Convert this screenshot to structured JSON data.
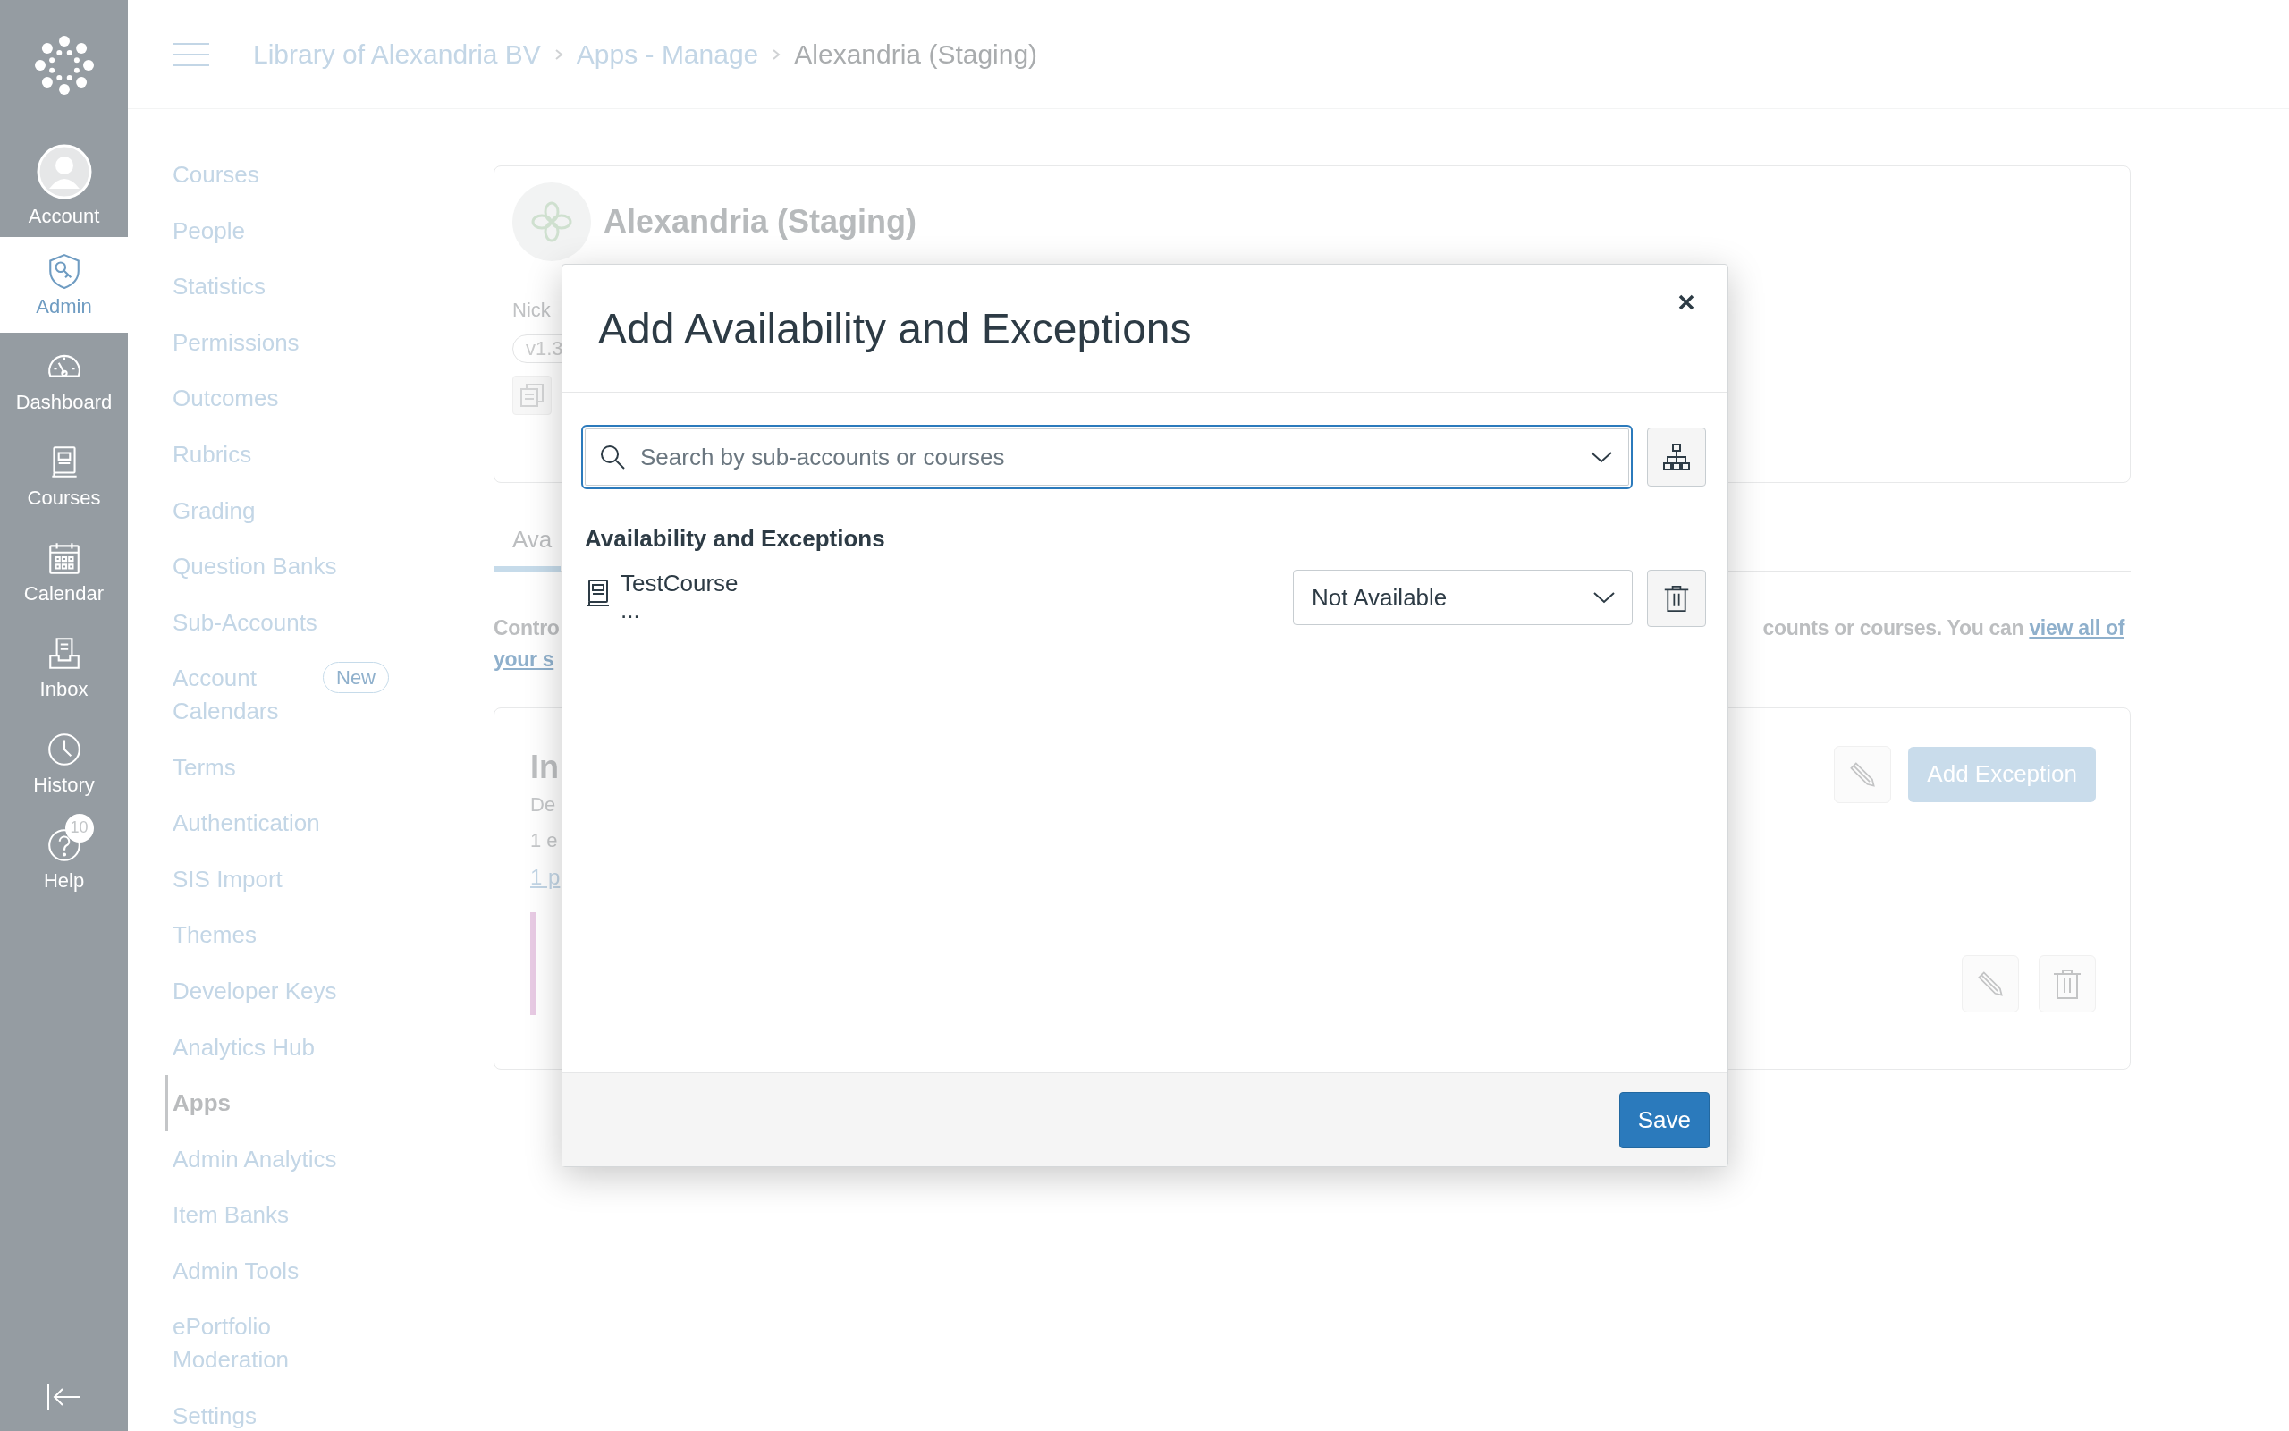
{
  "global_nav": {
    "items": [
      {
        "label": "Account",
        "kind": "avatar",
        "selected": false
      },
      {
        "label": "Admin",
        "kind": "admin",
        "selected": true
      },
      {
        "label": "Dashboard",
        "kind": "dashboard",
        "selected": false
      },
      {
        "label": "Courses",
        "kind": "courses",
        "selected": false
      },
      {
        "label": "Calendar",
        "kind": "calendar",
        "selected": false
      },
      {
        "label": "Inbox",
        "kind": "inbox",
        "selected": false
      },
      {
        "label": "History",
        "kind": "history",
        "selected": false
      },
      {
        "label": "Help",
        "kind": "help",
        "selected": false,
        "badge": "10"
      }
    ]
  },
  "breadcrumbs": [
    "Library of Alexandria BV",
    "Apps - Manage",
    "Alexandria (Staging)"
  ],
  "sub_nav": [
    {
      "label": "Courses",
      "selected": false
    },
    {
      "label": "People",
      "selected": false
    },
    {
      "label": "Statistics",
      "selected": false
    },
    {
      "label": "Permissions",
      "selected": false
    },
    {
      "label": "Outcomes",
      "selected": false
    },
    {
      "label": "Rubrics",
      "selected": false
    },
    {
      "label": "Grading",
      "selected": false
    },
    {
      "label": "Question Banks",
      "selected": false
    },
    {
      "label": "Sub-Accounts",
      "selected": false
    },
    {
      "label": "Account Calendars",
      "selected": false,
      "badge": "New"
    },
    {
      "label": "Terms",
      "selected": false
    },
    {
      "label": "Authentication",
      "selected": false
    },
    {
      "label": "SIS Import",
      "selected": false
    },
    {
      "label": "Themes",
      "selected": false
    },
    {
      "label": "Developer Keys",
      "selected": false
    },
    {
      "label": "Analytics Hub",
      "selected": false
    },
    {
      "label": "Apps",
      "selected": true
    },
    {
      "label": "Admin Analytics",
      "selected": false
    },
    {
      "label": "Item Banks",
      "selected": false
    },
    {
      "label": "Admin Tools",
      "selected": false
    },
    {
      "label": "ePortfolio Moderation",
      "selected": false
    },
    {
      "label": "Settings",
      "selected": false
    }
  ],
  "app_card": {
    "title": "Alexandria (Staging)",
    "nickname_label": "Nick",
    "version": "v1.3"
  },
  "tabs": [
    {
      "label": "Ava",
      "selected": true
    }
  ],
  "description": {
    "left_lines": [
      "Contro",
      "your s"
    ],
    "right_text": "counts or courses. You can",
    "right_link": "view all of"
  },
  "exception_card": {
    "heading": "In",
    "lines": [
      "De",
      "1 e"
    ],
    "link": "1 p",
    "button": "Add Exception"
  },
  "modal": {
    "title": "Add Availability and Exceptions",
    "search": {
      "placeholder": "Search by sub-accounts or courses"
    },
    "section_heading": "Availability and Exceptions",
    "rows": [
      {
        "name": "TestCourse",
        "detail": "...",
        "availability": "Not Available"
      }
    ],
    "save_button": "Save"
  }
}
